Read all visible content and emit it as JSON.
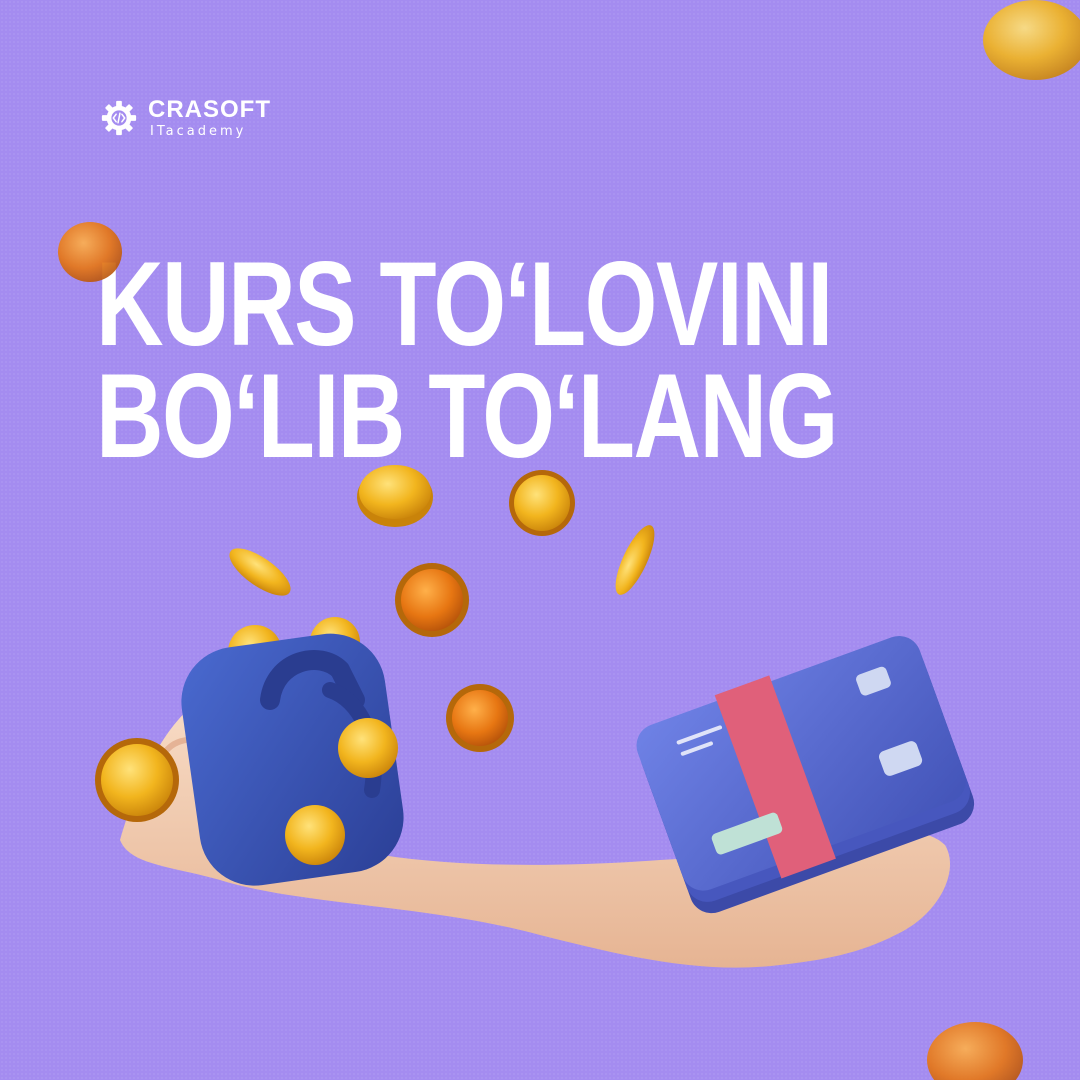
{
  "brand": {
    "name": "CRASOFT",
    "tagline": "ITacademy",
    "logo_icon": "gear-code-icon"
  },
  "headline": {
    "line1": "KURS TO‘LOVINI",
    "line2": "BO‘LIB TO‘LANG"
  },
  "colors": {
    "background": "#a48cf0",
    "text": "#ffffff",
    "coin": "#f2b51e",
    "wallet": "#3a56b8",
    "cards": "#5d6fd4",
    "band": "#e0607a",
    "hand": "#f1cdb3"
  },
  "illustration": {
    "subject": "hand holding wallet and card stack with falling coins",
    "icons": [
      "coin-icon",
      "wallet-icon",
      "card-stack-icon",
      "hand-icon"
    ]
  }
}
